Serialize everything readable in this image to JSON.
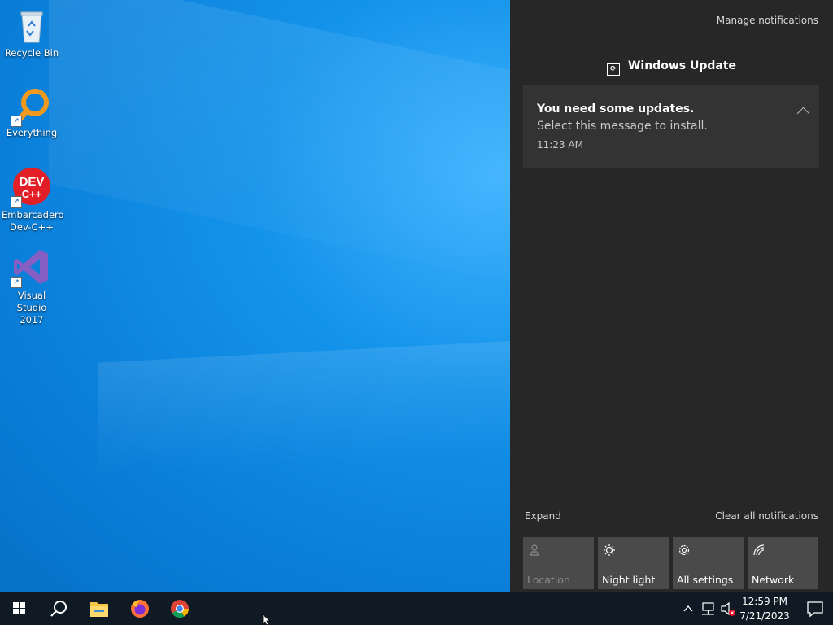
{
  "desktop": {
    "icons": [
      {
        "label": "Recycle Bin"
      },
      {
        "label": "Everything"
      },
      {
        "label": "Embarcadero\nDev-C++",
        "line1": "Embarcadero",
        "line2": "Dev-C++"
      },
      {
        "label": "Visual Studio\n2017",
        "line1": "Visual Studio",
        "line2": "2017"
      }
    ],
    "devcpp_logo_top": "DEV",
    "devcpp_logo_bottom": "C++"
  },
  "action_center": {
    "manage_label": "Manage notifications",
    "group_title": "Windows Update",
    "notification": {
      "title": "You need some updates.",
      "message": "Select this message to install.",
      "time": "11:23 AM"
    },
    "expand_label": "Expand",
    "clear_label": "Clear all notifications",
    "quick_actions": [
      {
        "label": "Location",
        "icon": "location-icon",
        "enabled": false
      },
      {
        "label": "Night light",
        "icon": "night-light-icon",
        "enabled": true
      },
      {
        "label": "All settings",
        "icon": "gear-icon",
        "enabled": true
      },
      {
        "label": "Network",
        "icon": "network-icon",
        "enabled": true
      }
    ]
  },
  "taskbar": {
    "pinned": [
      "windows-start-icon",
      "search-icon",
      "file-explorer-icon",
      "firefox-icon",
      "chrome-icon"
    ],
    "clock_time": "12:59 PM",
    "clock_date": "7/21/2023"
  },
  "colors": {
    "desktop_blue": "#0a7fd9",
    "panel_bg": "#272727",
    "card_bg": "#333333",
    "taskbar_bg": "#0f1a24"
  }
}
